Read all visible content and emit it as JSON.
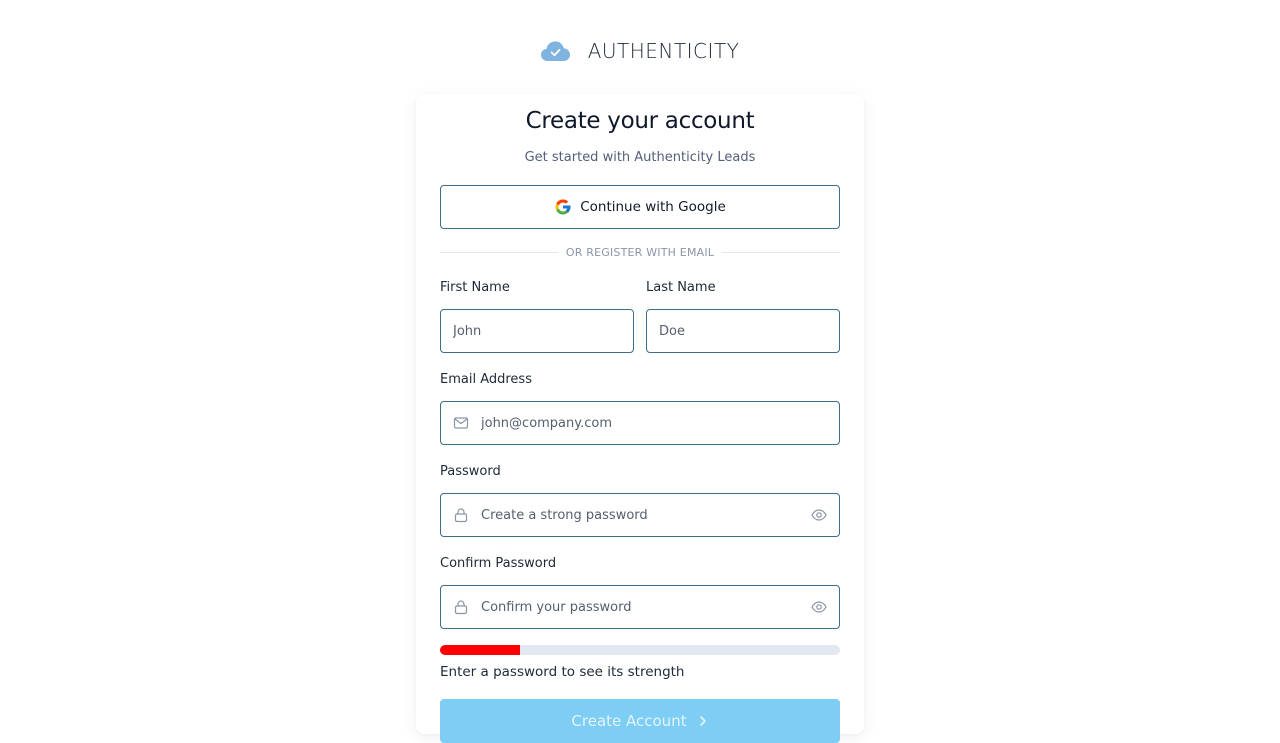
{
  "brand": {
    "name": "AUTHENTICITY",
    "logo_icon": "cloud-check-icon",
    "logo_color": "#7fb3e0"
  },
  "form": {
    "title": "Create your account",
    "subtitle": "Get started with Authenticity Leads",
    "google_button_label": "Continue with Google",
    "divider_text": "OR REGISTER WITH EMAIL",
    "first_name": {
      "label": "First Name",
      "placeholder": "John",
      "value": ""
    },
    "last_name": {
      "label": "Last Name",
      "placeholder": "Doe",
      "value": ""
    },
    "email": {
      "label": "Email Address",
      "placeholder": "john@company.com",
      "value": "",
      "icon": "mail-icon"
    },
    "password": {
      "label": "Password",
      "placeholder": "Create a strong password",
      "value": "",
      "icon": "lock-icon",
      "toggle_icon": "eye-icon"
    },
    "confirm_password": {
      "label": "Confirm Password",
      "placeholder": "Confirm your password",
      "value": "",
      "icon": "lock-icon",
      "toggle_icon": "eye-icon"
    },
    "strength": {
      "level": 0.2,
      "color": "#ff0000",
      "message": "Enter a password to see its strength"
    },
    "submit_label": "Create Account",
    "submit_color": "#7dcdf4"
  }
}
